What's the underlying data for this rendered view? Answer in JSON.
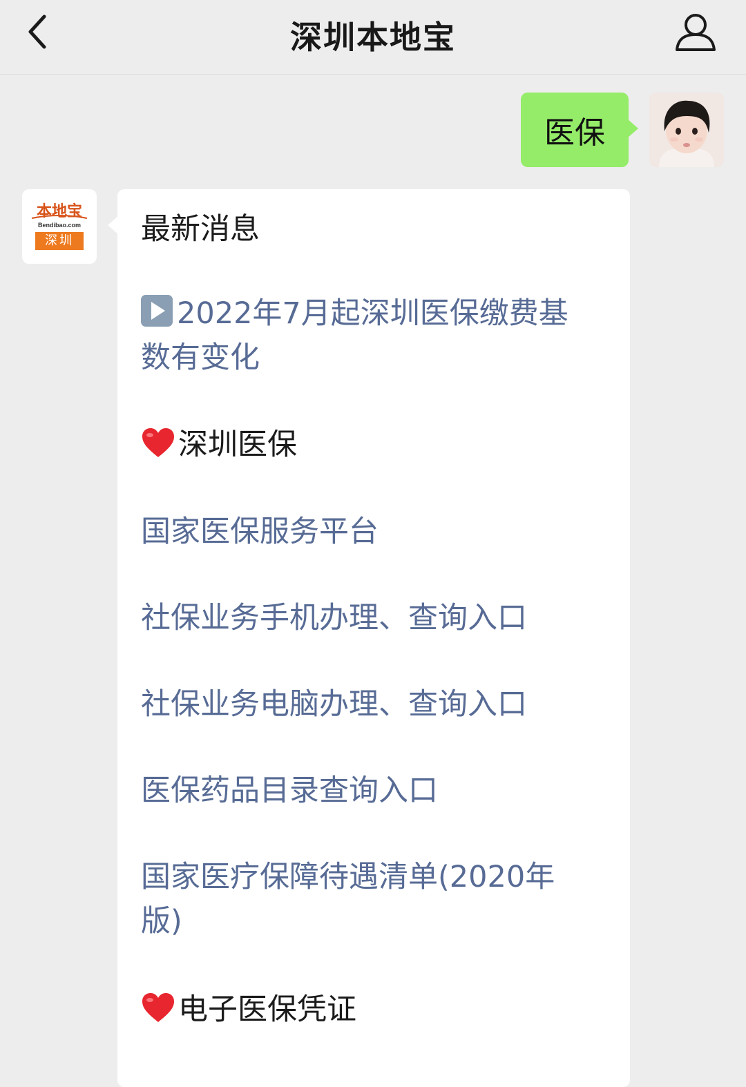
{
  "header": {
    "title": "深圳本地宝"
  },
  "icons": {
    "back": "chevron-left-icon",
    "profile": "person-icon",
    "play": "play-button-icon",
    "heart": "red-heart-icon"
  },
  "colors": {
    "user_bubble": "#95ec69",
    "link": "#576b95",
    "logo_orange": "#ee7a1f"
  },
  "user_message": {
    "text": "医保"
  },
  "bot_avatar": {
    "logo_top": "本地宝",
    "logo_mid": "Bendibao.com",
    "logo_city": "深圳"
  },
  "bot_message": {
    "heading": "最新消息",
    "news_link_line1": "2022年7月起深圳医保缴费基",
    "news_link_line2": "数有变化",
    "section1": "深圳医保",
    "links": [
      "国家医保服务平台",
      "社保业务手机办理、查询入口",
      "社保业务电脑办理、查询入口",
      "医保药品目录查询入口"
    ],
    "list_link_line1": "国家医疗保障待遇清单(2020年",
    "list_link_line2": "版)",
    "section2": "电子医保凭证"
  }
}
